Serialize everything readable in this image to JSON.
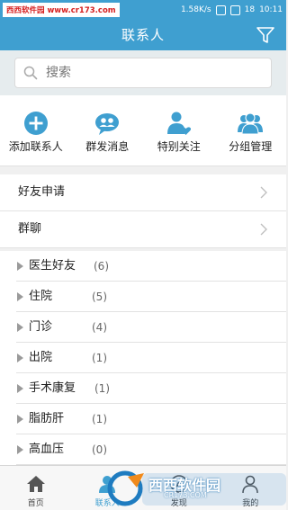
{
  "status_bar": {
    "watermark": "西西软件园 www.cr173.com",
    "speed": "1.58K/s",
    "battery": "18",
    "time": "10:11"
  },
  "header": {
    "title": "联系人",
    "filter_icon": "filter-funnel-icon"
  },
  "search": {
    "placeholder": "搜索",
    "icon": "search-icon"
  },
  "quick_actions": [
    {
      "label": "添加联系人",
      "icon": "plus-circle-icon"
    },
    {
      "label": "群发消息",
      "icon": "broadcast-icon"
    },
    {
      "label": "特别关注",
      "icon": "user-heart-icon"
    },
    {
      "label": "分组管理",
      "icon": "group-icon"
    }
  ],
  "list_rows": [
    {
      "label": "好友申请"
    },
    {
      "label": "群聊"
    }
  ],
  "groups": [
    {
      "name": "医生好友",
      "count": "(6)"
    },
    {
      "name": "住院",
      "count": "(5)"
    },
    {
      "name": "门诊",
      "count": "(4)"
    },
    {
      "name": "出院",
      "count": "(1)"
    },
    {
      "name": "手术康复",
      "count": "(1)"
    },
    {
      "name": "脂肪肝",
      "count": "(1)"
    },
    {
      "name": "高血压",
      "count": "(0)"
    }
  ],
  "tabs": [
    {
      "label": "首页",
      "icon": "home-icon"
    },
    {
      "label": "联系人",
      "icon": "contacts-icon"
    },
    {
      "label": "发现",
      "icon": "discover-icon"
    },
    {
      "label": "我的",
      "icon": "profile-icon"
    }
  ],
  "watermark_overlay": {
    "brand": "西西软件园",
    "url": "CR173.COM"
  },
  "colors": {
    "primary": "#3f9fd0",
    "watermark_red": "#d62020"
  }
}
